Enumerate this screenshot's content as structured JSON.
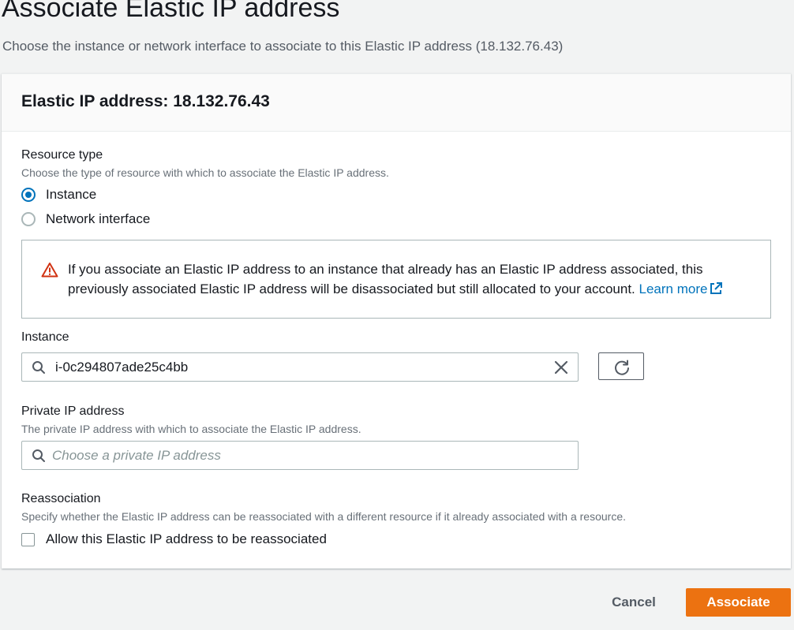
{
  "page": {
    "title": "Associate Elastic IP address",
    "description": "Choose the instance or network interface to associate to this Elastic IP address (18.132.76.43)"
  },
  "panel": {
    "title": "Elastic IP address: 18.132.76.43"
  },
  "resource_type": {
    "label": "Resource type",
    "description": "Choose the type of resource with which to associate the Elastic IP address.",
    "options": [
      {
        "label": "Instance",
        "selected": true
      },
      {
        "label": "Network interface",
        "selected": false
      }
    ]
  },
  "warning": {
    "text": "If you associate an Elastic IP address to an instance that already has an Elastic IP address associated, this previously associated Elastic IP address will be disassociated but still allocated to your account.",
    "link_label": "Learn more",
    "icon": "warning-triangle-icon",
    "color": "#d13212"
  },
  "instance": {
    "label": "Instance",
    "value": "i-0c294807ade25c4bb",
    "refresh_icon": "refresh-icon",
    "clear_icon": "close-icon"
  },
  "private_ip": {
    "label": "Private IP address",
    "description": "The private IP address with which to associate the Elastic IP address.",
    "placeholder": "Choose a private IP address",
    "value": ""
  },
  "reassociation": {
    "label": "Reassociation",
    "description": "Specify whether the Elastic IP address can be reassociated with a different resource if it already associated with a resource.",
    "checkbox_label": "Allow this Elastic IP address to be reassociated",
    "checked": false
  },
  "footer": {
    "cancel_label": "Cancel",
    "submit_label": "Associate",
    "accent": "#ec7211"
  },
  "colors": {
    "link": "#0073bb",
    "background": "#f2f3f3"
  }
}
